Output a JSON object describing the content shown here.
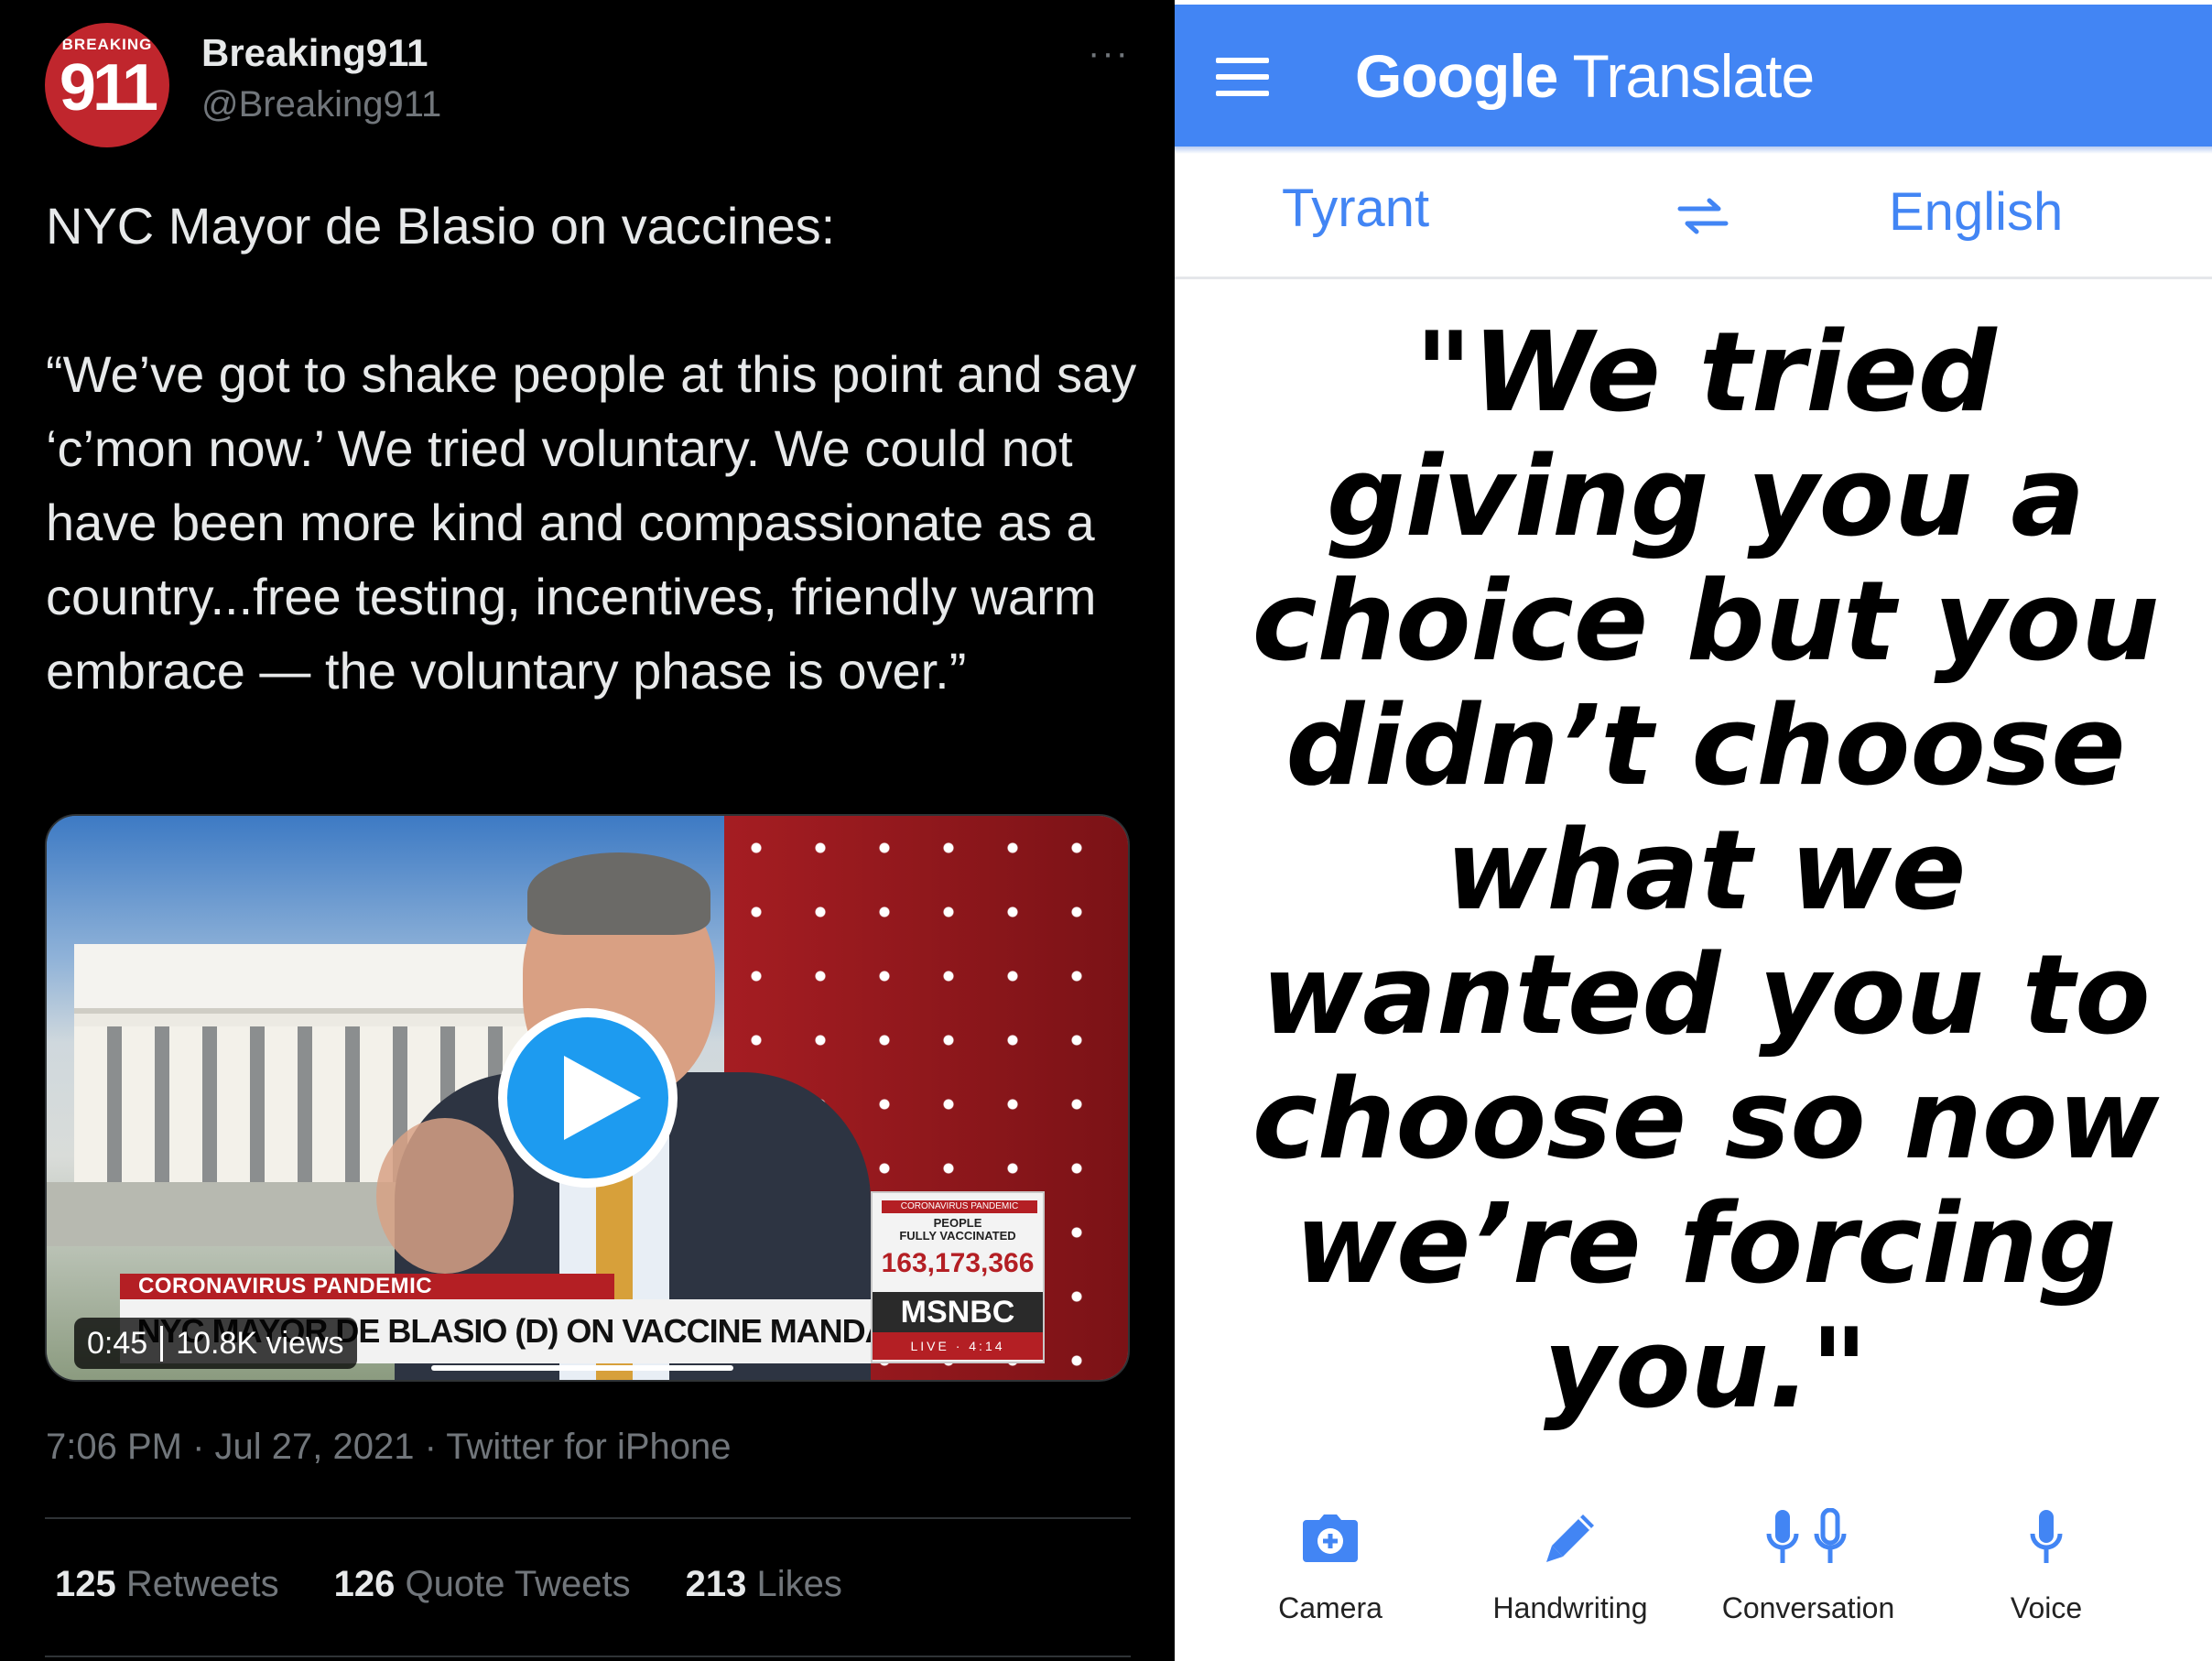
{
  "tweet": {
    "avatar": {
      "top_text": "BREAKING",
      "number": "911"
    },
    "display_name": "Breaking911",
    "handle": "@Breaking911",
    "more": "···",
    "intro": "NYC Mayor de Blasio on vaccines:",
    "quote": "“We’ve got to shake people at this point and say ‘c’mon now.’ We tried voluntary. We could not have been more kind and compassionate as a country...free testing, incentives, friendly warm embrace — the voluntary phase is over.”",
    "video": {
      "lower_third": "CORONAVIRUS PANDEMIC",
      "headline": "NYC MAYOR DE BLASIO (D) ON VACCINE MANDATE",
      "ticker_caption": "CORONAVIRUS PANDEMIC",
      "ticker_label": "PEOPLE\nFULLY VACCINATED",
      "ticker_value": "163,173,366",
      "network": "MSNBC",
      "live": "LIVE · 4:14",
      "duration": "0:45",
      "views": "10.8K views"
    },
    "timestamp": "7:06 PM · Jul 27, 2021 · Twitter for iPhone",
    "stats": {
      "retweets_count": "125",
      "retweets_label": "Retweets",
      "quotes_count": "126",
      "quotes_label": "Quote Tweets",
      "likes_count": "213",
      "likes_label": "Likes"
    }
  },
  "translate": {
    "brand_google": "Google",
    "brand_translate": "Translate",
    "source_language": "Tyrant",
    "target_language": "English",
    "translation": "\"We tried giving you a choice but you didn’t choose what we wanted you to choose so now we’re forcing you.\"",
    "tools": {
      "camera": "Camera",
      "handwriting": "Handwriting",
      "conversation": "Conversation",
      "voice": "Voice"
    }
  },
  "colors": {
    "google_blue": "#4285f4",
    "twitter_blue": "#1d9bf0",
    "msnbc_red": "#b41f24"
  }
}
